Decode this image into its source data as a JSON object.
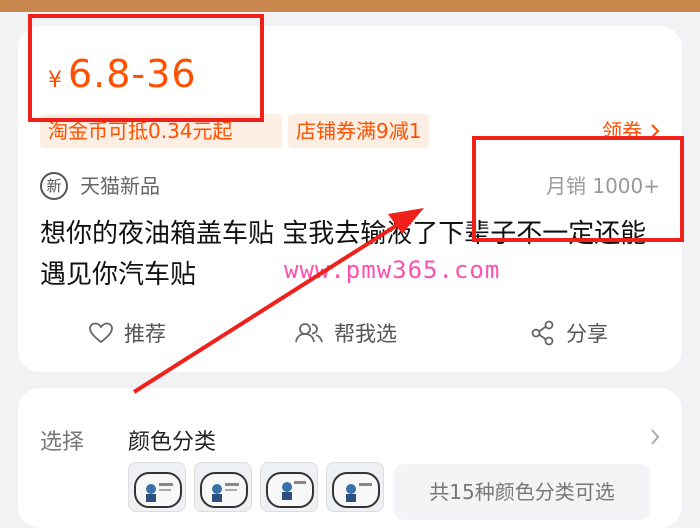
{
  "price": {
    "symbol": "¥",
    "range": "6.8-36"
  },
  "tags": [
    "淘金币可抵0.34元起",
    "店铺券满9减1"
  ],
  "coupon": {
    "label": "领券"
  },
  "source": {
    "badge": "新",
    "label": "天猫新品"
  },
  "sales": "月销 1000+",
  "product": {
    "title": "想你的夜油箱盖车贴 宝我去输液了下辈子不一定还能遇见你汽车贴"
  },
  "watermark": "www.pmw365.com",
  "actions": {
    "recommend": "推荐",
    "help_choose": "帮我选",
    "share": "分享"
  },
  "selection": {
    "label": "选择",
    "category": "颜色分类",
    "more": "共15种颜色分类可选"
  },
  "colors": {
    "accent": "#ff5000",
    "annotation": "#f0201a",
    "watermark": "#ff4fb0"
  }
}
